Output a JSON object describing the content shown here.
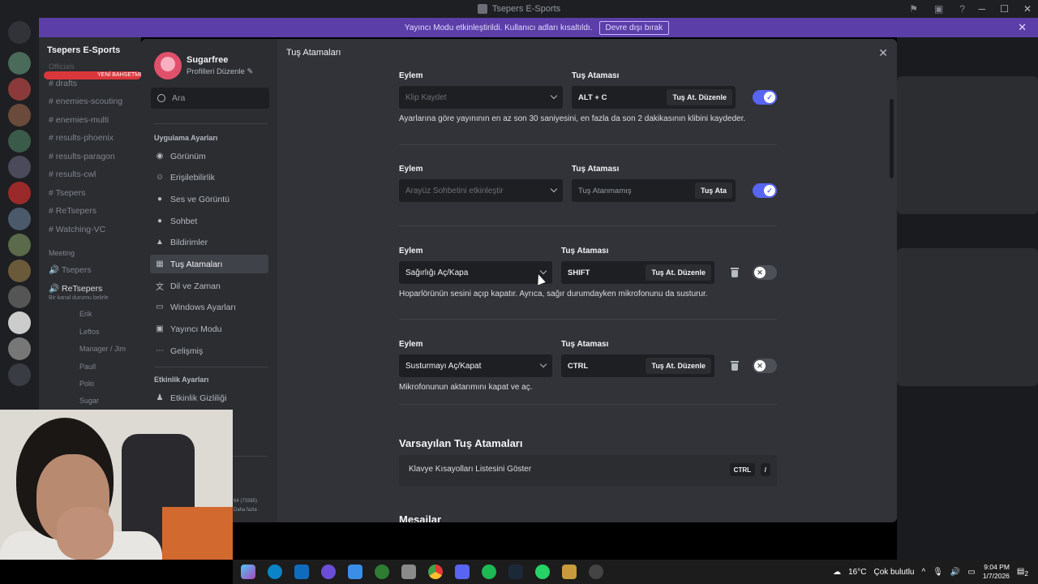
{
  "window": {
    "title": "Tsepers E-Sports"
  },
  "banner": {
    "text": "Yayıncı Modu etkinleştirildi. Kullanıcı adları kısaltıldı.",
    "button": "Devre dışı bırak"
  },
  "server": {
    "name": "Tsepers E-Sports",
    "channels": [
      "drafts",
      "enemies-scouting",
      "enemies-multi",
      "results-phoenix",
      "results-paragon",
      "results-cwl",
      "Tsepers",
      "ReTsepers",
      "Watching-VC"
    ],
    "category": "Meeting",
    "voice": [
      "Tsepers",
      "ReTsepers"
    ],
    "voice_status": "Bir kanal durumu belirle",
    "members": [
      "Erik",
      "Leftos",
      "Manager / Jim",
      "Paull",
      "Polo",
      "Sugar"
    ],
    "new_badge": "YENİ BAHSETME",
    "officials": "Officials"
  },
  "settings": {
    "profile": {
      "name": "Sugarfree",
      "edit": "Profilleri Düzenle"
    },
    "search_placeholder": "Ara",
    "section_app": "Uygulama Ayarları",
    "nav": [
      {
        "label": "Görünüm",
        "icon": "palette-icon"
      },
      {
        "label": "Erişilebilirlik",
        "icon": "accessibility-icon"
      },
      {
        "label": "Ses ve Görüntü",
        "icon": "microphone-icon"
      },
      {
        "label": "Sohbet",
        "icon": "chat-icon"
      },
      {
        "label": "Bildirimler",
        "icon": "bell-icon"
      },
      {
        "label": "Tuş Atamaları",
        "icon": "keyboard-icon"
      },
      {
        "label": "Dil ve Zaman",
        "icon": "language-icon"
      },
      {
        "label": "Windows Ayarları",
        "icon": "monitor-icon"
      },
      {
        "label": "Yayıncı Modu",
        "icon": "streamer-icon"
      },
      {
        "label": "Gelişmiş",
        "icon": "more-icon"
      }
    ],
    "section_activity": "Etkinlik Ayarları",
    "nav_activity": {
      "label": "Etkinlik Gizliliği",
      "icon": "privacy-icon"
    },
    "footer_a": "64 (73385)",
    "footer_b": "Daha fazla"
  },
  "page": {
    "title": "Tuş Atamaları",
    "action_label": "Eylem",
    "bind_label": "Tuş Ataması",
    "keybinds": [
      {
        "action": "Klip Kaydet",
        "key": "ALT + C",
        "button": "Tuş At. Düzenle",
        "enabled": true,
        "desc": "Ayarlarına göre yayınının en az son 30 saniyesini, en fazla da son 2 dakikasının klibini kaydeder."
      },
      {
        "action": "Arayüz Sohbetini etkinleştir",
        "key": "Tuş Atanmamış",
        "button": "Tuş Ata",
        "enabled": true,
        "desc": ""
      },
      {
        "action": "Sağırlığı Aç/Kapa",
        "key": "SHIFT",
        "button": "Tuş At. Düzenle",
        "enabled": false,
        "desc": "Hoparlörünün sesini açıp kapatır. Ayrıca, sağır durumdayken mikrofonunu da susturur."
      },
      {
        "action": "Susturmayı Aç/Kapat",
        "key": "CTRL",
        "button": "Tuş At. Düzenle",
        "enabled": false,
        "desc": "Mikrofonunun aktarımını kapat ve aç."
      }
    ],
    "defaults_heading": "Varsayılan Tuş Atamaları",
    "defaults_row": {
      "label": "Klavye Kısayolları Listesini Göster",
      "keys": [
        "CTRL",
        "/"
      ]
    },
    "messages_heading": "Mesajlar"
  },
  "taskbar": {
    "weather": "16°C",
    "weather_text": "Çok bulutlu",
    "time": "9:04 PM",
    "date": "1/7/2026",
    "notif_count": "2"
  },
  "colors": {
    "accent": "#5865f2",
    "banner": "#5b3ea8"
  }
}
